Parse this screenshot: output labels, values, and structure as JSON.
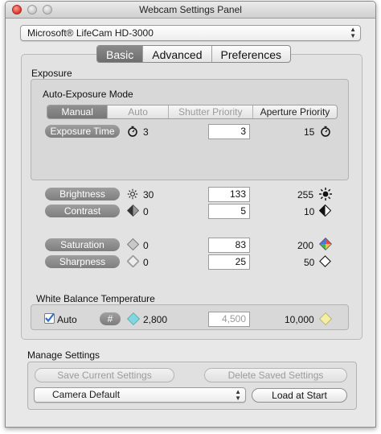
{
  "window": {
    "title": "Webcam Settings Panel"
  },
  "camera_select": {
    "value": "Microsoft® LifeCam HD-3000"
  },
  "tabs": [
    {
      "label": "Basic",
      "active": true
    },
    {
      "label": "Advanced",
      "active": false
    },
    {
      "label": "Preferences",
      "active": false
    }
  ],
  "exposure": {
    "section_label": "Exposure",
    "mode_label": "Auto-Exposure Mode",
    "modes": [
      {
        "label": "Manual",
        "selected": true,
        "enabled": true
      },
      {
        "label": "Auto",
        "selected": false,
        "enabled": false
      },
      {
        "label": "Shutter Priority",
        "selected": false,
        "enabled": false
      },
      {
        "label": "Aperture Priority",
        "selected": false,
        "enabled": true
      }
    ],
    "time": {
      "label": "Exposure Time",
      "min": "3",
      "value": "3",
      "max": "15",
      "icon": "timer-icon"
    }
  },
  "image_controls": {
    "brightness": {
      "label": "Brightness",
      "min": "30",
      "value": "133",
      "max": "255",
      "min_icon": "sun-small-icon",
      "max_icon": "sun-large-icon"
    },
    "contrast": {
      "label": "Contrast",
      "min": "0",
      "value": "5",
      "max": "10",
      "min_icon": "contrast-low-icon",
      "max_icon": "contrast-high-icon"
    },
    "saturation": {
      "label": "Saturation",
      "min": "0",
      "value": "83",
      "max": "200",
      "min_icon": "saturation-low-icon",
      "max_icon": "saturation-high-icon"
    },
    "sharpness": {
      "label": "Sharpness",
      "min": "0",
      "value": "25",
      "max": "50",
      "min_icon": "sharpness-low-icon",
      "max_icon": "sharpness-high-icon"
    }
  },
  "white_balance": {
    "section_label": "White Balance Temperature",
    "auto_label": "Auto",
    "auto_checked": true,
    "hash_label": "#",
    "min": "2,800",
    "value": "4,500",
    "max": "10,000",
    "min_color": "#7fd8e0",
    "max_color": "#f3f0a3"
  },
  "manage": {
    "section_label": "Manage Settings",
    "save_label": "Save Current Settings",
    "delete_label": "Delete Saved Settings",
    "preset_value": "Camera Default",
    "load_label": "Load at Start"
  },
  "colors": {
    "accent_gray": "#7e7e7e",
    "checkbox_blue": "#2a6fd1"
  }
}
